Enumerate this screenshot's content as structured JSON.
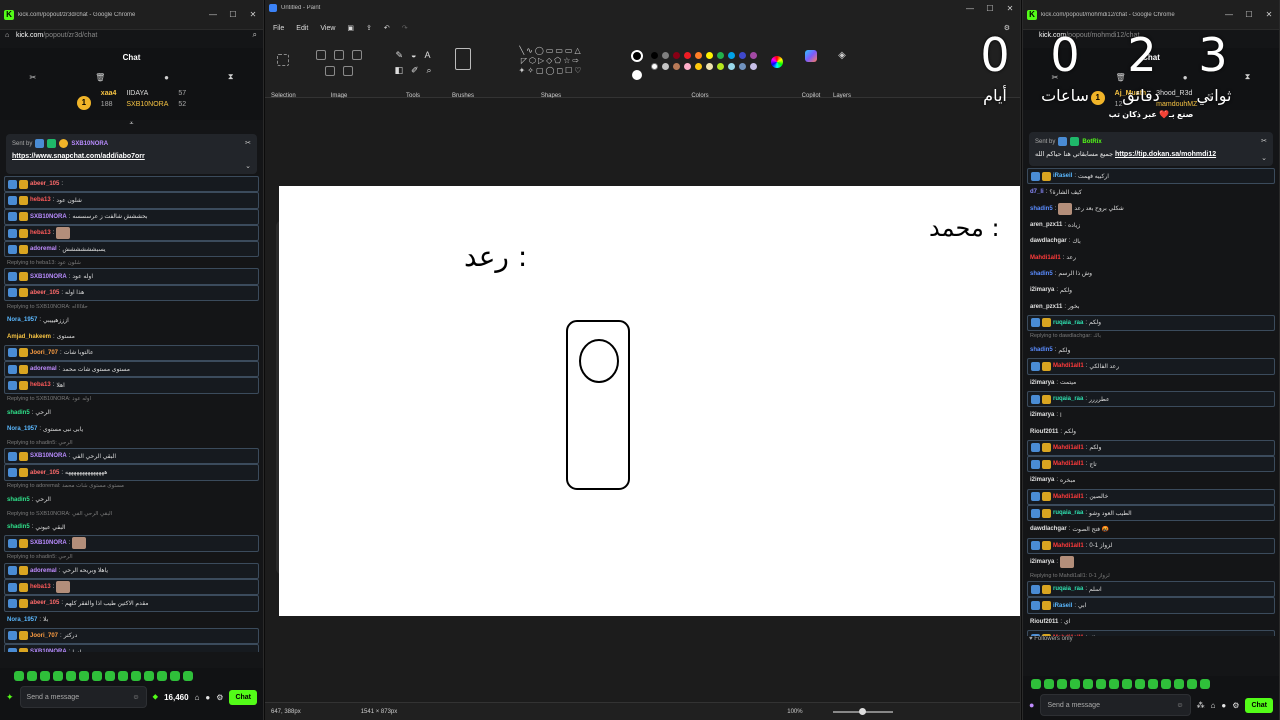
{
  "left": {
    "title": "kick.com/popout/zr3d/chat - Google Chrome",
    "url_host": "kick.com",
    "url_path": "/popout/zr3d/chat",
    "chat_header": "Chat",
    "leaders": [
      {
        "name": "xaa4",
        "count": "188"
      },
      {
        "name": "IIDAYA",
        "count": "57"
      },
      {
        "name": "SXB10NORA",
        "count": "52"
      }
    ],
    "pinned": {
      "by_label": "Sent by",
      "user": "SXB10NORA",
      "link": "https://www.snapchat.com/add/iabo7orr"
    },
    "messages": [
      {
        "type": "msg",
        "user": "abeer_105",
        "color": "#ff6b6b",
        "text": "",
        "hl": true
      },
      {
        "type": "msg",
        "user": "heba13",
        "color": "#ff5a5a",
        "text": "شلون عود",
        "hl": true
      },
      {
        "type": "msg",
        "user": "SXB10NORA",
        "color": "#b98cff",
        "text": "بحششش شالفت ز عرسسسه",
        "hl": true
      },
      {
        "type": "msg",
        "user": "heba13",
        "color": "#ff5a5a",
        "text": "",
        "hl": true,
        "emote": true
      },
      {
        "type": "msg",
        "user": "adoremal",
        "color": "#c08cff",
        "text": "يسبشششششش",
        "hl": true
      },
      {
        "type": "reply",
        "text": "Replying to heba13: شلون عود"
      },
      {
        "type": "msg",
        "user": "SXB10NORA",
        "color": "#b98cff",
        "text": "اوله عود",
        "hl": true
      },
      {
        "type": "msg",
        "user": "abeer_105",
        "color": "#ff6b6b",
        "text": "هذا اوله",
        "hl": true
      },
      {
        "type": "reply",
        "text": "Replying to SXB10NORA: حلاااااه"
      },
      {
        "type": "msg",
        "user": "Nora_1957",
        "color": "#5ab8ff",
        "text": "ازززهيييبي",
        "hl": false
      },
      {
        "type": "msg",
        "user": "Amjad_hakeem",
        "color": "#f6c343",
        "text": "مستوى",
        "hl": false
      },
      {
        "type": "msg",
        "user": "Joori_707",
        "color": "#ff9f43",
        "text": "عالتوبا شات",
        "hl": true
      },
      {
        "type": "msg",
        "user": "adoremal",
        "color": "#c08cff",
        "text": "مستوى مستوى شات محمد",
        "hl": true
      },
      {
        "type": "msg",
        "user": "heba13",
        "color": "#ff5a5a",
        "text": "اهلا",
        "hl": true
      },
      {
        "type": "reply",
        "text": "Replying to SXB10NORA: اوله عود"
      },
      {
        "type": "msg",
        "user": "shadin5",
        "color": "#2fe08a",
        "text": "الرحي",
        "hl": false
      },
      {
        "type": "msg",
        "user": "Nora_1957",
        "color": "#5ab8ff",
        "text": "يابى نبى مستوى",
        "hl": false
      },
      {
        "type": "reply",
        "text": "Replying to shadin5: الرحي"
      },
      {
        "type": "msg",
        "user": "SXB10NORA",
        "color": "#b98cff",
        "text": "البقي الرحي الفي",
        "hl": true
      },
      {
        "type": "msg",
        "user": "abeer_105",
        "color": "#ff6b6b",
        "text": "ههههههههههههههه",
        "hl": true
      },
      {
        "type": "reply",
        "text": "Replying to adoremal: مستوى مستوى شات محمد"
      },
      {
        "type": "msg",
        "user": "shadin5",
        "color": "#2fe08a",
        "text": "الرحي",
        "hl": false
      },
      {
        "type": "reply",
        "text": "Replying to SXB10NORA: البقي الرحي الفي"
      },
      {
        "type": "msg",
        "user": "shadin5",
        "color": "#2fe08a",
        "text": "البقي عيوني",
        "hl": false
      },
      {
        "type": "msg",
        "user": "SXB10NORA",
        "color": "#b98cff",
        "text": "",
        "hl": true,
        "emote": true
      },
      {
        "type": "reply",
        "text": "Replying to shadin5: الرحي"
      },
      {
        "type": "msg",
        "user": "adoremal",
        "color": "#c08cff",
        "text": "ياهلا وبريحه الرحي",
        "hl": true
      },
      {
        "type": "msg",
        "user": "heba13",
        "color": "#ff5a5a",
        "text": "",
        "hl": true,
        "emote": true
      },
      {
        "type": "msg",
        "user": "abeer_105",
        "color": "#ff6b6b",
        "text": "مقدم الاكتين طيب اذا والفقر كلهم",
        "hl": true
      },
      {
        "type": "msg",
        "user": "Nora_1957",
        "color": "#5ab8ff",
        "text": "بلا",
        "hl": false
      },
      {
        "type": "msg",
        "user": "Joori_707",
        "color": "#ff9f43",
        "text": "دركتر",
        "hl": true
      },
      {
        "type": "msg",
        "user": "SXB10NORA",
        "color": "#b98cff",
        "text": "مرادوا",
        "hl": true
      },
      {
        "type": "reply",
        "text": "Replying to adoremal: ياهلا وبريحه الرحي"
      },
      {
        "type": "msg",
        "user": "shadin5",
        "color": "#2fe08a",
        "text": "البقمي عيوني كيفك",
        "hl": false
      }
    ],
    "send_placeholder": "Send a message",
    "points": "16,460",
    "chat_button": "Chat"
  },
  "paint": {
    "title": "Untitled - Paint",
    "menu": [
      "File",
      "Edit",
      "View"
    ],
    "groups": [
      "Selection",
      "Image",
      "Tools",
      "Brushes",
      "Shapes",
      "Colors",
      "Copilot",
      "Layers"
    ],
    "status_cursor": "647, 388px",
    "status_size": "1541 × 873px",
    "zoom": "100%",
    "colors": [
      "#000000",
      "#7f7f7f",
      "#880015",
      "#ed1c24",
      "#ff7f27",
      "#fff200",
      "#22b14c",
      "#00a2e8",
      "#3f48cc",
      "#a349a4",
      "#ffffff",
      "#c3c3c3",
      "#b97a57",
      "#ffaec9",
      "#ffc90e",
      "#efe4b0",
      "#b5e61d",
      "#99d9ea",
      "#7092be",
      "#c8bfe7"
    ],
    "sketch_text_left": "رعد :",
    "sketch_text_right": "محمد :"
  },
  "right": {
    "title": "kick.com/popout/mohmdi12/chat - Google Chrome",
    "url_host": "kick.com",
    "url_path": "/popout/mohmdi12/chat",
    "chat_header": "Chat",
    "leaders": [
      {
        "name": "Aj_Muath",
        "count": "12"
      },
      {
        "name": "3hood_R3d",
        "count": ""
      },
      {
        "name": "mamdouhMZ",
        "count": "5"
      }
    ],
    "overlay_text": "صنع بـ❤️ عبر ذكان تب",
    "pinned": {
      "by_label": "Sent by",
      "user": "BotRix",
      "text": "جميع مسابقاتي هنا حياكم الله",
      "link": "https://tip.dokan.sa/mohmdi12"
    },
    "messages": [
      {
        "type": "msg",
        "user": "iRaseil",
        "color": "#5ab8ff",
        "text": "اركبيه فهمت",
        "hl": true
      },
      {
        "type": "msg",
        "user": "d7_li",
        "color": "#8b8bff",
        "text": "كيف الشارة؟",
        "hl": false
      },
      {
        "type": "msg",
        "user": "shadin5",
        "color": "#5a8cff",
        "text": "شكلي بروح بعد رعد",
        "hl": false,
        "emote": true
      },
      {
        "type": "msg",
        "user": "aren_pzx11",
        "color": "#e0e0e0",
        "text": "زياده",
        "hl": false
      },
      {
        "type": "msg",
        "user": "dawdlachgar",
        "color": "#e0e0e0",
        "text": "باك",
        "hl": false
      },
      {
        "type": "msg",
        "user": "Mahdi1all1",
        "color": "#ff3b3b",
        "text": "رعد",
        "hl": false
      },
      {
        "type": "msg",
        "user": "shadin5",
        "color": "#5a8cff",
        "text": "وش ذا الرسم",
        "hl": false
      },
      {
        "type": "msg",
        "user": "i2imarya",
        "color": "#e0e0e0",
        "text": "ولكم",
        "hl": false
      },
      {
        "type": "msg",
        "user": "aren_pzx11",
        "color": "#e0e0e0",
        "text": "بخور",
        "hl": false
      },
      {
        "type": "msg",
        "user": "ruqaia_raa",
        "color": "#2fe0b0",
        "text": "ولكم",
        "hl": true
      },
      {
        "type": "reply",
        "text": "Replying to dawdlachgar: باك"
      },
      {
        "type": "msg",
        "user": "shadin5",
        "color": "#5a8cff",
        "text": "ولكم",
        "hl": false
      },
      {
        "type": "msg",
        "user": "Mahdi1all1",
        "color": "#ff3b3b",
        "text": "رعد الفالكي",
        "hl": true
      },
      {
        "type": "msg",
        "user": "i2imarya",
        "color": "#e0e0e0",
        "text": "ميتمت",
        "hl": false
      },
      {
        "type": "msg",
        "user": "ruqaia_raa",
        "color": "#2fe0b0",
        "text": "عطرررر",
        "hl": true
      },
      {
        "type": "msg",
        "user": "i2imarya",
        "color": "#e0e0e0",
        "text": "ا",
        "hl": false
      },
      {
        "type": "msg",
        "user": "Riouf2011",
        "color": "#e0e0e0",
        "text": "ولكم",
        "hl": false
      },
      {
        "type": "msg",
        "user": "Mahdi1all1",
        "color": "#ff3b3b",
        "text": "ولكم",
        "hl": true
      },
      {
        "type": "msg",
        "user": "Mahdi1all1",
        "color": "#ff3b3b",
        "text": "تاج",
        "hl": true
      },
      {
        "type": "msg",
        "user": "i2imarya",
        "color": "#e0e0e0",
        "text": "مبخره",
        "hl": false
      },
      {
        "type": "msg",
        "user": "Mahdi1all1",
        "color": "#ff3b3b",
        "text": "خالصين",
        "hl": true
      },
      {
        "type": "msg",
        "user": "ruqaia_raa",
        "color": "#2fe0b0",
        "text": "الطيب العود وشو",
        "hl": true
      },
      {
        "type": "msg",
        "user": "dawdlachgar",
        "color": "#e0e0e0",
        "text": "فتح الصوت 🤬",
        "hl": false
      },
      {
        "type": "msg",
        "user": "Mahdi1all1",
        "color": "#ff3b3b",
        "text": "لزواز 1-0",
        "hl": true
      },
      {
        "type": "msg",
        "user": "i2imarya",
        "color": "#e0e0e0",
        "text": "",
        "hl": false,
        "emote": true
      },
      {
        "type": "reply",
        "text": "Replying to Mahdi1all1: لزواز 1-0"
      },
      {
        "type": "msg",
        "user": "ruqaia_raa",
        "color": "#2fe0b0",
        "text": "اسلم",
        "hl": true
      },
      {
        "type": "msg",
        "user": "iRaseil",
        "color": "#5ab8ff",
        "text": "ابي",
        "hl": true
      },
      {
        "type": "msg",
        "user": "Riouf2011",
        "color": "#e0e0e0",
        "text": "اي",
        "hl": false
      },
      {
        "type": "msg",
        "user": "Mahdi1all1",
        "color": "#ff3b3b",
        "text": "جوال",
        "hl": true
      }
    ],
    "followers_only": "Followers only",
    "send_placeholder": "Send a message",
    "chat_button": "Chat"
  },
  "countdown": {
    "values": [
      "3",
      "2",
      "0",
      "0"
    ],
    "labels": [
      "ثواني",
      "دقائق",
      "ساعات",
      "أيام"
    ]
  }
}
